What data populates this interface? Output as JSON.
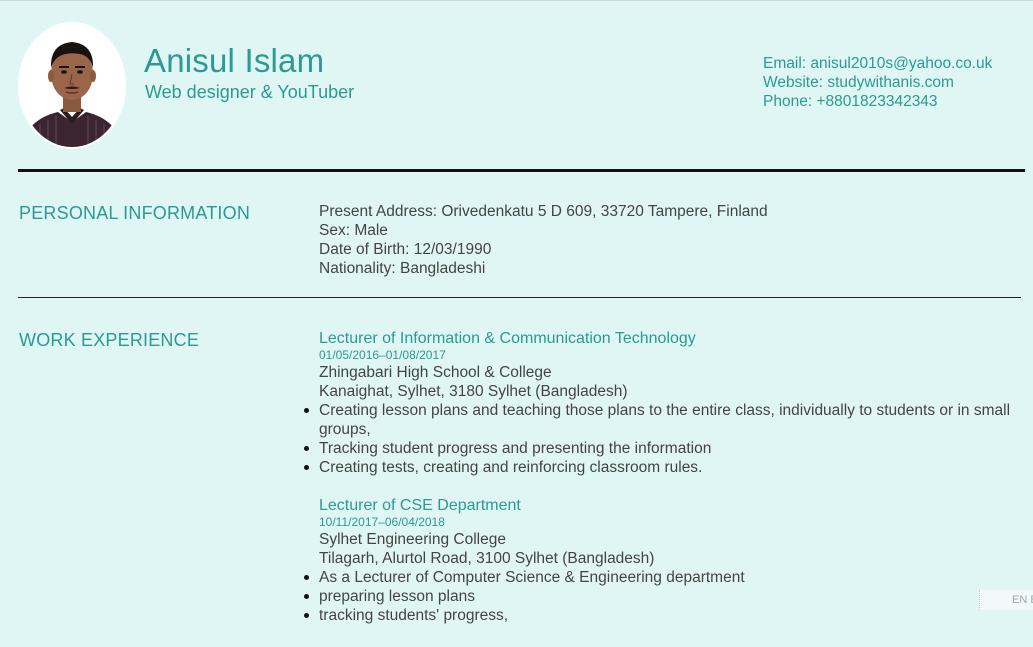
{
  "profile": {
    "name": "Anisul Islam",
    "title": "Web designer & YouTuber"
  },
  "contact": {
    "email": "Email: anisul2010s@yahoo.co.uk",
    "website": "Website: studywithanis.com",
    "phone": "Phone: +8801823342343"
  },
  "personal": {
    "heading": "PERSONAL INFORMATION",
    "address": "Present Address: Orivedenkatu 5 D 609, 33720 Tampere, Finland",
    "sex": "Sex: Male",
    "dob": "Date of Birth: 12/03/1990",
    "nationality": "Nationality: Bangladeshi"
  },
  "work": {
    "heading": "WORK EXPERIENCE",
    "jobs": [
      {
        "title": "Lecturer of Information & Communication Technology",
        "dates": "01/05/2016–01/08/2017",
        "employer": "Zhingabari High School & College",
        "location": "Kanaighat, Sylhet, 3180 Sylhet (Bangladesh)",
        "duties": [
          "Creating lesson plans and teaching those plans to the entire class, individually to students or in small",
          "groups,",
          "Tracking student progress and presenting the information",
          "Creating tests, creating and reinforcing classroom rules."
        ]
      },
      {
        "title": "Lecturer of CSE Department",
        "dates": "10/11/2017–06/04/2018",
        "employer": "Sylhet Engineering College",
        "location": "Tilagarh, Alurtol Road, 3100 Sylhet (Bangladesh)",
        "duties": [
          "As a Lecturer of Computer Science & Engineering department",
          "preparing lesson plans",
          "tracking students' progress,"
        ]
      }
    ]
  },
  "lang_widget": {
    "label": "EN E"
  },
  "colors": {
    "background": "#e0f6f4",
    "accent": "#2a9a92",
    "text": "#444444"
  },
  "icons": {
    "avatar": "profile-photo"
  }
}
